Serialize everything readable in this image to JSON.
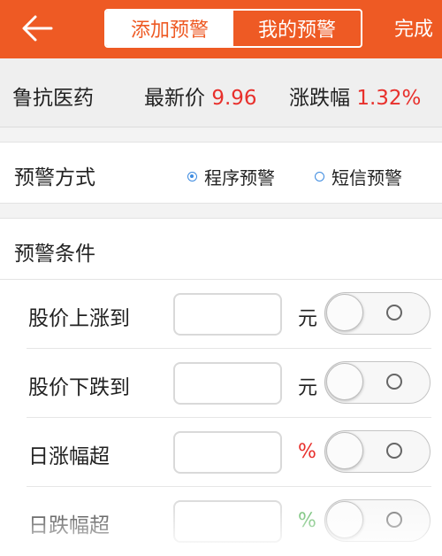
{
  "header": {
    "tabs": [
      {
        "label": "添加预警",
        "active": true
      },
      {
        "label": "我的预警",
        "active": false
      }
    ],
    "done_label": "完成"
  },
  "stock": {
    "name": "鲁抗医药",
    "price_label": "最新价",
    "price_value": "9.96",
    "change_label": "涨跌幅",
    "change_value": "1.32%"
  },
  "alert_mode": {
    "label": "预警方式",
    "options": [
      {
        "label": "程序预警",
        "selected": true
      },
      {
        "label": "短信预警",
        "selected": false
      }
    ]
  },
  "conditions": {
    "title": "预警条件",
    "items": [
      {
        "label": "股价上涨到",
        "unit": "元",
        "value": "",
        "enabled": false
      },
      {
        "label": "股价下跌到",
        "unit": "元",
        "value": "",
        "enabled": false
      },
      {
        "label": "日涨幅超",
        "unit": "%",
        "value": "",
        "enabled": false
      },
      {
        "label": "日跌幅超",
        "unit": "%",
        "value": "",
        "enabled": false
      }
    ]
  },
  "colors": {
    "brand": "#ee5a24",
    "price_up": "#e8302c",
    "price_down": "#4caf50",
    "radio": "#3d8be0"
  }
}
